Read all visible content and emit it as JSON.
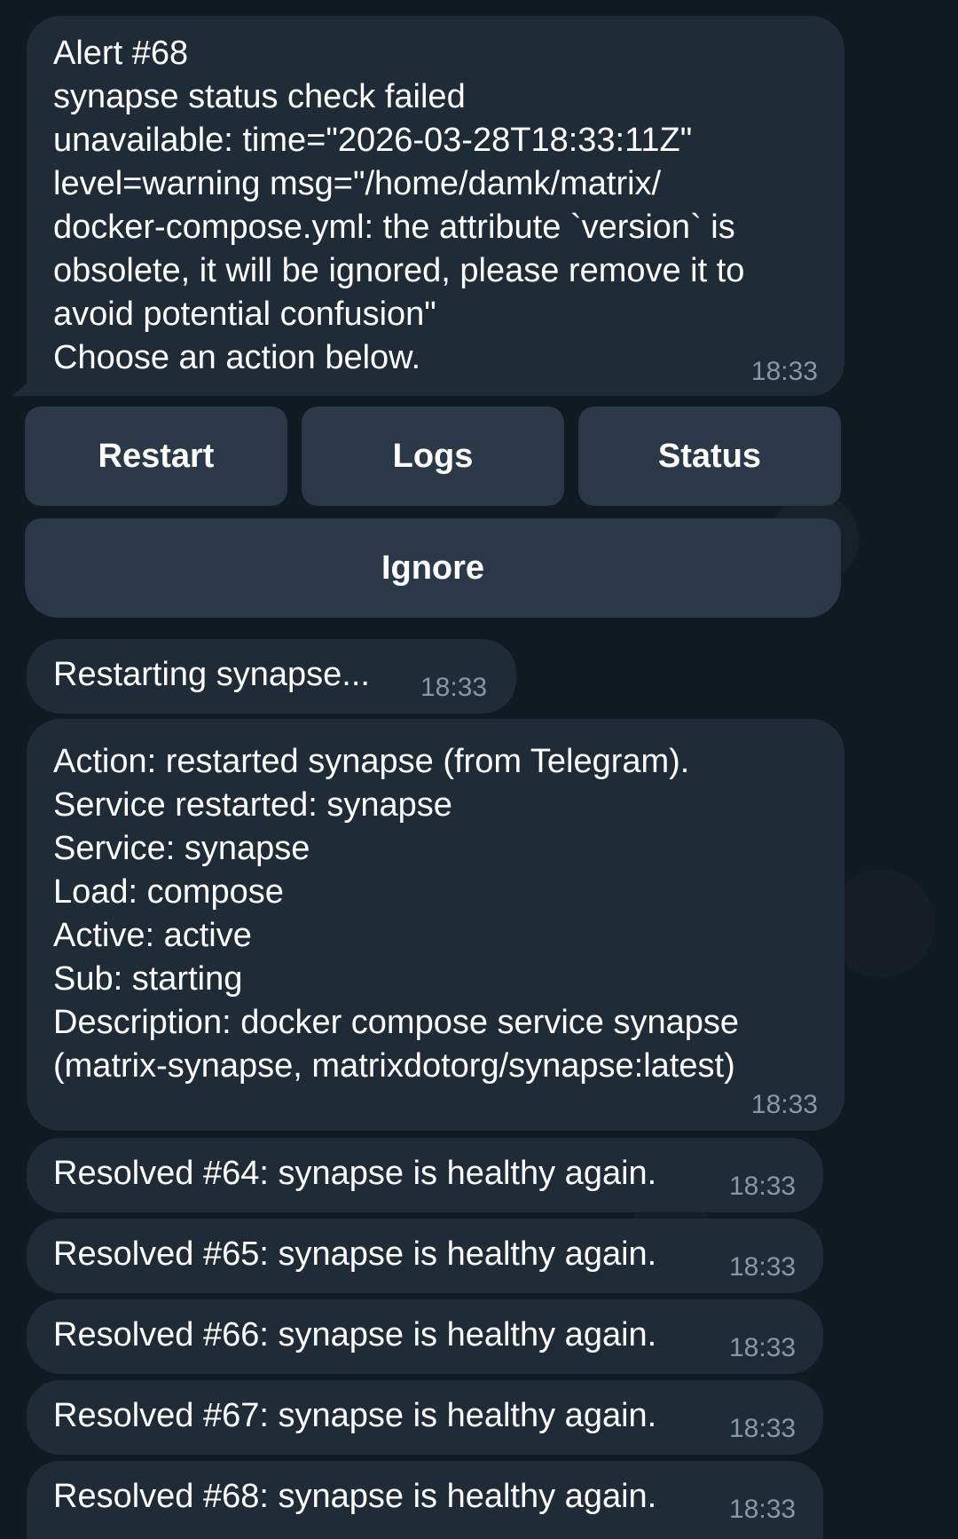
{
  "messages": {
    "alert": {
      "text": "Alert #68\nsynapse status check failed\nunavailable: time=\"2026-03-28T18:33:11Z\"\nlevel=warning msg=\"/home/damk/matrix/\ndocker-compose.yml: the attribute `version` is\nobsolete, it will be ignored, please remove it to\navoid potential confusion\"\nChoose an action below.",
      "time": "18:33"
    },
    "keyboard": {
      "restart": "Restart",
      "logs": "Logs",
      "status": "Status",
      "ignore": "Ignore"
    },
    "restarting": {
      "text": "Restarting synapse...",
      "time": "18:33"
    },
    "action_result": {
      "text": "Action: restarted synapse (from Telegram).\nService restarted: synapse\nService: synapse\nLoad: compose\nActive: active\nSub: starting\nDescription: docker compose service synapse\n(matrix-synapse, matrixdotorg/synapse:latest)",
      "time": "18:33"
    },
    "resolved": [
      {
        "text": "Resolved #64: synapse is healthy again.",
        "time": "18:33"
      },
      {
        "text": "Resolved #65: synapse is healthy again.",
        "time": "18:33"
      },
      {
        "text": "Resolved #66: synapse is healthy again.",
        "time": "18:33"
      },
      {
        "text": "Resolved #67: synapse is healthy again.",
        "time": "18:33"
      },
      {
        "text": "Resolved #68: synapse is healthy again.",
        "time": "18:33"
      }
    ]
  },
  "colors": {
    "background": "#101a22",
    "bubble": "#1f2c38",
    "button": "#2a3847",
    "timestamp": "#8697a6"
  }
}
